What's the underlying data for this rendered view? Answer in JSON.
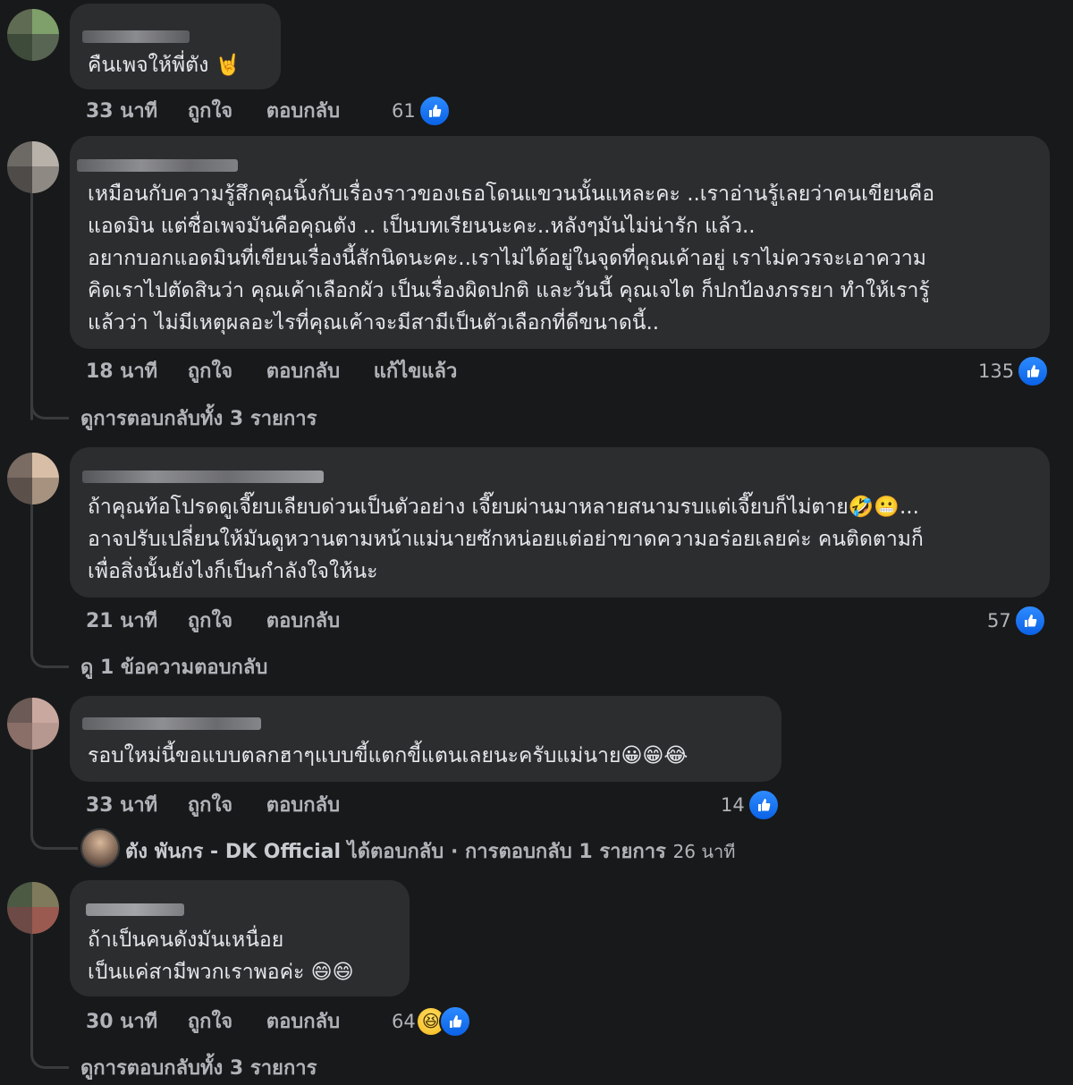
{
  "comments": [
    {
      "lines": [
        "คืนเพจให้พี่ตัง 🤘"
      ],
      "time": "33 นาที",
      "like_label": "ถูกใจ",
      "reply_label": "ตอบกลับ",
      "reaction_count": "61",
      "reactions": [
        "like-icon"
      ]
    },
    {
      "lines": [
        "เหมือนกับความรู้สึกคุณนิ้งกับเรื่องราวของเธอโดนแขวนนั้นแหละคะ ..เราอ่านรู้เลยว่าคนเขียนคือ",
        "แอดมิน แต่ชื่อเพจมันคือคุณตัง .. เป็นบทเรียนนะคะ..หลังๆมันไม่น่ารัก แล้ว..",
        "อยากบอกแอดมินที่เขียนเรื่องนี้สักนิดนะคะ..เราไม่ได้อยู่ในจุดที่คุณเค้าอยู่ เราไม่ควรจะเอาความ",
        "คิดเราไปตัดสินว่า คุณเค้าเลือกผัว เป็นเรื่องผิดปกติ และวันนี้ คุณเจไต ก็ปกป้องภรรยา ทำให้เรารู้",
        "แล้วว่า ไม่มีเหตุผลอะไรที่คุณเค้าจะมีสามีเป็นตัวเลือกที่ดีขนาดนี้.."
      ],
      "time": "18 นาที",
      "like_label": "ถูกใจ",
      "reply_label": "ตอบกลับ",
      "edited_label": "แก้ไขแล้ว",
      "reaction_count": "135",
      "reactions": [
        "like-icon"
      ],
      "view_replies": "ดูการตอบกลับทั้ง 3 รายการ"
    },
    {
      "lines": [
        "ถ้าคุณท้อโปรดดูเจี๊ยบเลียบด่วนเป็นตัวอย่าง เจี๊ยบผ่านมาหลายสนามรบแต่เจี๊ยบก็ไม่ตาย🤣😬...",
        "อาจปรับเปลี่ยนให้มันดูหวานตามหน้าแม่นายซักหน่อยแต่อย่าขาดความอร่อยเลยค่ะ คนติดตามก็",
        "เพื่อสิ่งนั้นยังไงก็เป็นกำลังใจให้นะ"
      ],
      "time": "21 นาที",
      "like_label": "ถูกใจ",
      "reply_label": "ตอบกลับ",
      "reaction_count": "57",
      "reactions": [
        "like-icon"
      ],
      "view_replies": "ดู 1 ข้อความตอบกลับ"
    },
    {
      "lines": [
        "รอบใหม่นี้ขอแบบตลกฮาๆแบบขี้แตกขี้แตนเลยนะครับแม่นาย😀😁😂"
      ],
      "time": "33 นาที",
      "like_label": "ถูกใจ",
      "reply_label": "ตอบกลับ",
      "reaction_count": "14",
      "reactions": [
        "like-icon"
      ],
      "page_reply": {
        "name": "ตัง พันกร - DK Official",
        "action": "ได้ตอบกลับ",
        "separator": "·",
        "count_text": "การตอบกลับ 1 รายการ",
        "time": "26 นาที"
      }
    },
    {
      "lines": [
        "ถ้าเป็นคนดังมันเหนื่อย",
        "เป็นแค่สามีพวกเราพอค่ะ 😄😄"
      ],
      "time": "30 นาที",
      "like_label": "ถูกใจ",
      "reply_label": "ตอบกลับ",
      "reaction_count": "64",
      "reactions": [
        "haha-icon",
        "like-icon"
      ],
      "view_replies": "ดูการตอบกลับทั้ง 3 รายการ"
    }
  ],
  "colors": {
    "background": "#18191a",
    "bubble": "#2c2d2f",
    "text": "#e4e6eb",
    "meta": "#b0b3b8",
    "like_blue": "#1877f2"
  }
}
